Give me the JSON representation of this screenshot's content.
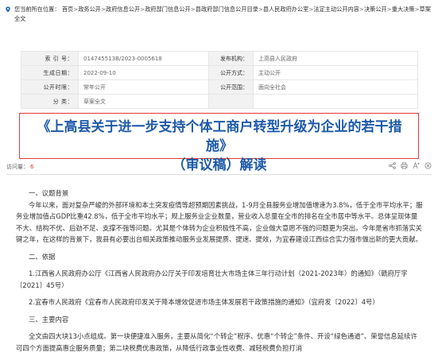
{
  "breadcrumb": {
    "prefix": "您当前所在位置：",
    "items": [
      "首页",
      "政务公开",
      "政府信息公开",
      "政府部门信息公开",
      "县政府部门信息公开目录",
      "县人民政府办公室",
      "法定主动公开内容",
      "决策公开",
      "重大决策",
      "草案全文"
    ],
    "separator": ">"
  },
  "meta": {
    "index_label": "索 引 号：",
    "index_value": "014745513B/2023-0005618",
    "publisher_label": "发布机构：",
    "publisher_value": "上高县人民政府",
    "date_label": "生成日期：",
    "date_value": "2022-09-10",
    "method_label": "公开方式：",
    "method_value": "主动公开",
    "period_label": "公开时限：",
    "period_value": "常年公开",
    "scope_label": "公开范围：",
    "scope_value": "面向全社会",
    "category_label": "分 类：",
    "category_value": "草案全文"
  },
  "title": {
    "line1": "《上高县关于进一步支持个体工商户转型升级为企业的若干措施》",
    "line2": "（审议稿）解读"
  },
  "stats": {
    "visits_label": "访问量：",
    "visits_value": "6"
  },
  "tools": [
    "share-icon",
    "print-icon",
    "text-size-icon",
    "close-icon"
  ],
  "article": {
    "s1_heading": "一、议题背景",
    "s1_para": "今年以来，面对复杂严峻的外部环境和本土突发疫情等超预期因素挑战，1-9月全县服务业增加值增速为3.8%，低于全市平均水平；服务业增加值占GDP比重42.8%，低于全市平均水平；规上服务业企业数量，营业收入总量在全市的排名在全市居中等水平。总体呈现体量不大、结构不优、后劲不足、支撑不强等问题。尤其是个体转为企业积极性不高，企业做大意愿不强的问题更为突出。今年是省市抓落实关键之年，在这样的背景下，我县有必要出台相关政策推动服务业发展提质、提速、提效，为宜春建设江西综合实力强市做出新的更大贡献。",
    "s2_heading": "二、依据",
    "s2_item1": "1.江西省人民政府办公厅《江西省人民政府办公厅关于印发培育壮大市场主体三年行动计划（2021-2023年）的通知》（赣府厅字〔2021〕45号）",
    "s2_item2": "2.宜春市人民政府《宜春市人民政府印发关于降本增效促进市场主体发展若干政策措施的通知》（宜府发〔2022〕4号）",
    "s3_heading": "三、主要内容",
    "s3_para": "全文由四大块13小点组成。第一块便捷准入服务，主要从简化“个转企”程序、优惠“个转企”条件、开设“绿色通道”、荣誉信息延续许可四个方面提高惠企服务质量；第二块税费优惠政策，从降低行政事业性收费、减轻税费负担打消"
  }
}
